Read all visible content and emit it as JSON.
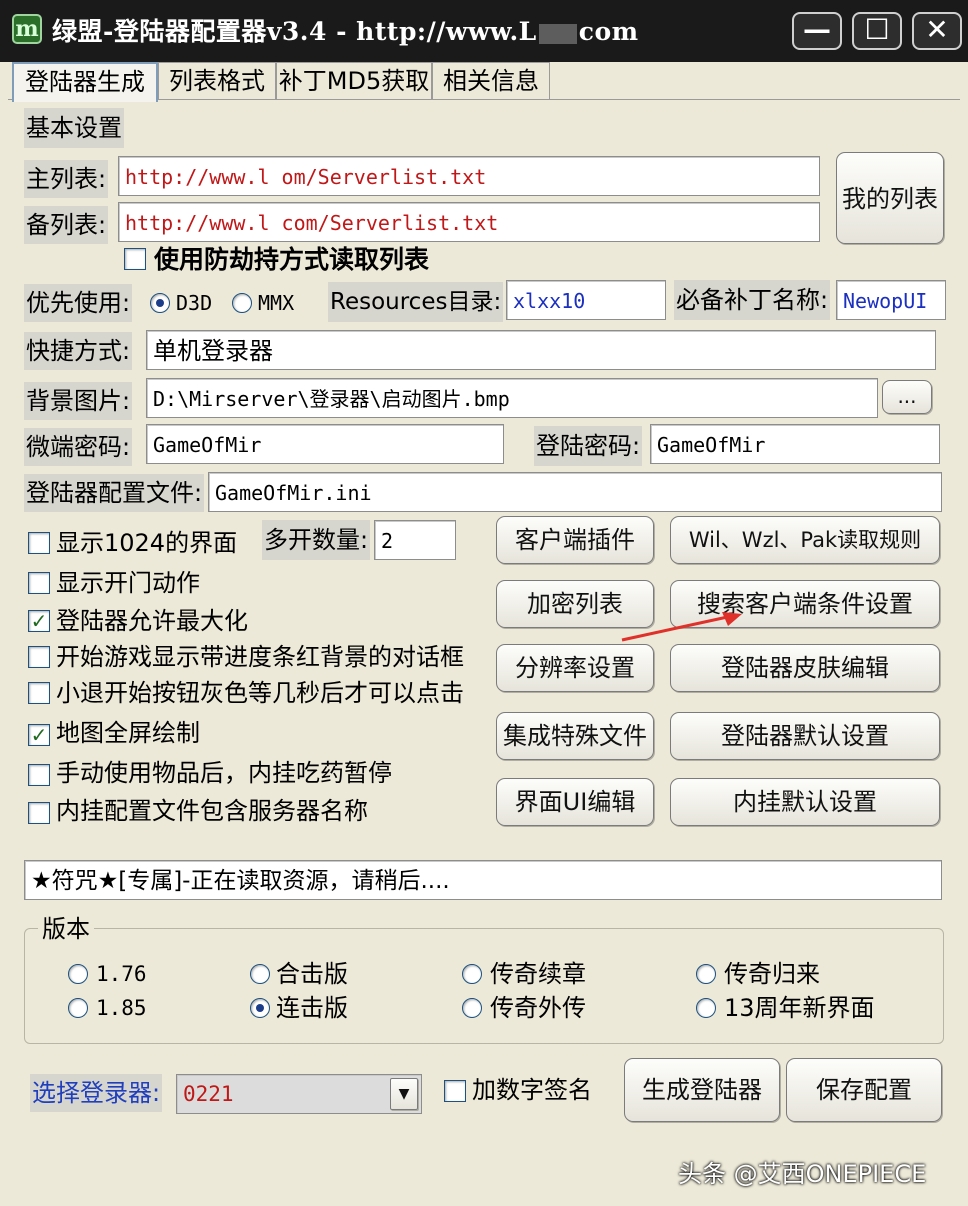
{
  "window": {
    "title": "绿盟-登陆器配置器v3.4 - http://www.L",
    "title_suffix": "com",
    "minimize": "—",
    "maximize": "☐",
    "close": "✕"
  },
  "tabs": [
    "登陆器生成",
    "列表格式",
    "补丁MD5获取",
    "相关信息"
  ],
  "basic": {
    "section_label": "基本设置",
    "main_list_label": "主列表:",
    "main_list_value": "http://www.l    om/Serverlist.txt",
    "backup_list_label": "备列表:",
    "backup_list_value": "http://www.l     com/Serverlist.txt",
    "my_list_button": "我的列表",
    "anti_hijack_label": "使用防劫持方式读取列表",
    "priority_label": "优先使用:",
    "d3d_label": "D3D",
    "mmx_label": "MMX",
    "resources_label": "Resources目录:",
    "resources_value": "xlxx10",
    "patch_label": "必备补丁名称:",
    "patch_value": "NewopUI",
    "shortcut_label": "快捷方式:",
    "shortcut_value": "单机登录器",
    "bg_label": "背景图片:",
    "bg_value": "D:\\Mirserver\\登录器\\启动图片.bmp",
    "browse_button": "...",
    "micro_pwd_label": "微端密码:",
    "micro_pwd_value": "GameOfMir",
    "login_pwd_label": "登陆密码:",
    "login_pwd_value": "GameOfMir",
    "config_file_label": "登陆器配置文件:",
    "config_file_value": "GameOfMir.ini"
  },
  "options": [
    {
      "label": "显示1024的界面",
      "checked": false
    },
    {
      "label": "显示开门动作",
      "checked": false
    },
    {
      "label": "登陆器允许最大化",
      "checked": true
    },
    {
      "label": "开始游戏显示带进度条红背景的对话框",
      "checked": false
    },
    {
      "label": "小退开始按钮灰色等几秒后才可以点击",
      "checked": false
    },
    {
      "label": "地图全屏绘制",
      "checked": true
    },
    {
      "label": "手动使用物品后，内挂吃药暂停",
      "checked": false
    },
    {
      "label": "内挂配置文件包含服务器名称",
      "checked": false
    }
  ],
  "multi_open": {
    "label": "多开数量:",
    "value": "2"
  },
  "buttons": {
    "client_plugin": "客户端插件",
    "wil_rules": "Wil、Wzl、Pak读取规则",
    "encrypt_list": "加密列表",
    "search_client": "搜索客户端条件设置",
    "resolution": "分辨率设置",
    "skin_edit": "登陆器皮肤编辑",
    "special_files": "集成特殊文件",
    "default_settings": "登陆器默认设置",
    "ui_edit": "界面UI编辑",
    "plugin_defaults": "内挂默认设置"
  },
  "status_text": "★符咒★[专属]-正在读取资源，请稍后....",
  "version": {
    "title": "版本",
    "options": [
      {
        "label": "1.76",
        "selected": false
      },
      {
        "label": "合击版",
        "selected": false
      },
      {
        "label": "传奇续章",
        "selected": false
      },
      {
        "label": "传奇归来",
        "selected": false
      },
      {
        "label": "1.85",
        "selected": false
      },
      {
        "label": "连击版",
        "selected": true
      },
      {
        "label": "传奇外传",
        "selected": false
      },
      {
        "label": "13周年新界面",
        "selected": false
      }
    ]
  },
  "bottom": {
    "select_label": "选择登录器:",
    "select_value": "0221",
    "signature_label": "加数字签名",
    "generate_button": "生成登陆器",
    "save_button": "保存配置"
  },
  "watermark": "头条 @艾西ONEPIECE",
  "colors": {
    "url_text": "#c01818",
    "input_blue": "#1b2fc0",
    "arrow": "#e0302a",
    "label_blue": "#1f3fbf"
  }
}
